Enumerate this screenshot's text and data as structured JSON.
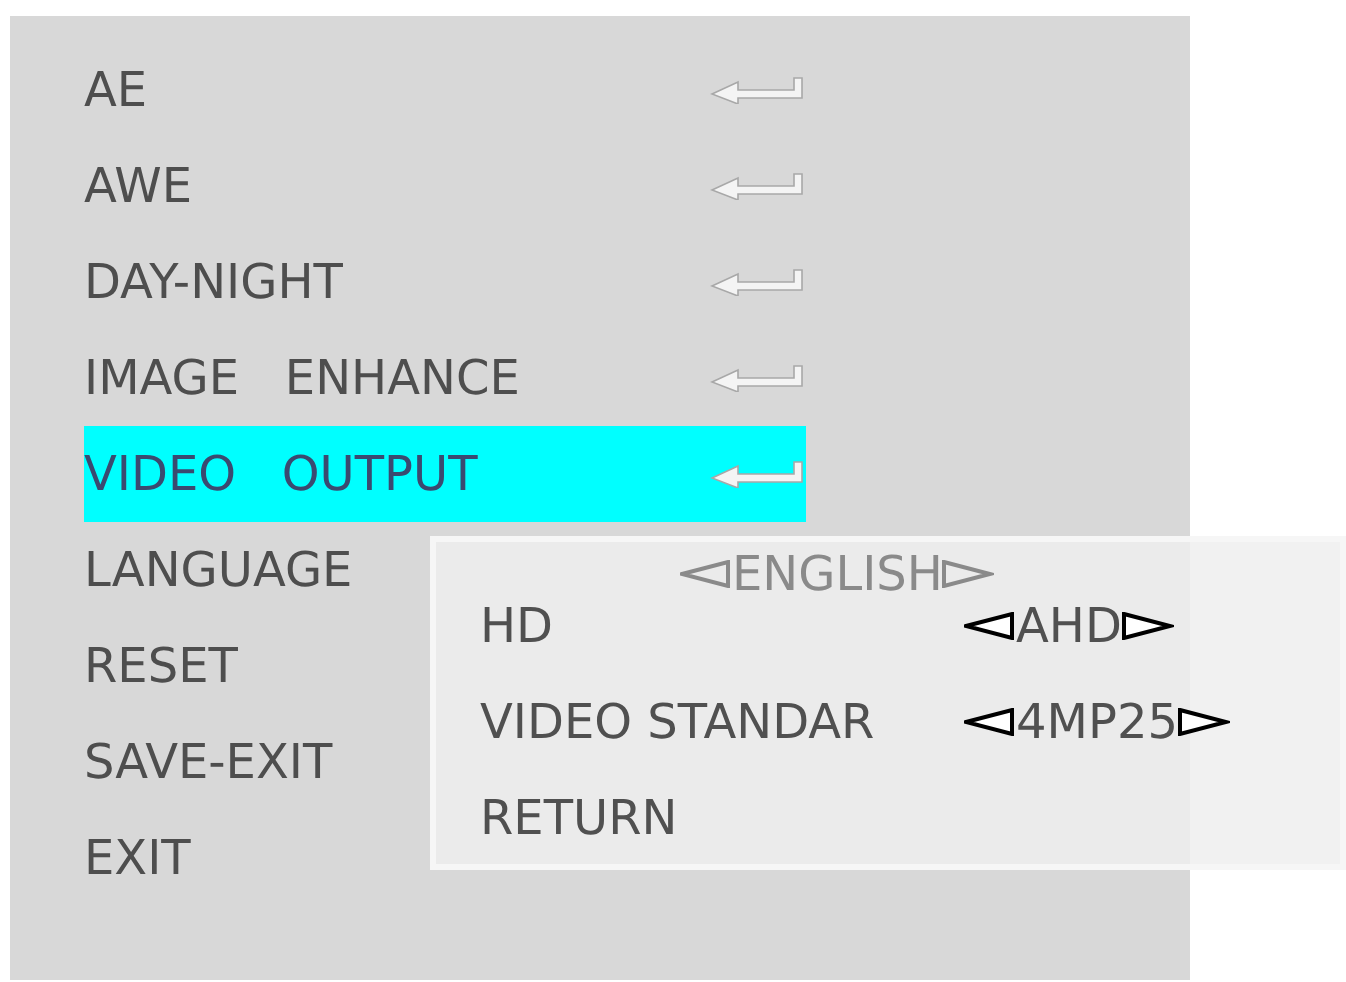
{
  "menu": {
    "items": [
      {
        "label": "AE",
        "kind": "submenu",
        "selected": false
      },
      {
        "label": "AWE",
        "kind": "submenu",
        "selected": false
      },
      {
        "label": "DAY-NIGHT",
        "kind": "submenu",
        "selected": false
      },
      {
        "label": "IMAGE   ENHANCE",
        "kind": "submenu",
        "selected": false
      },
      {
        "label": "VIDEO   OUTPUT",
        "kind": "submenu",
        "selected": true
      },
      {
        "label": "LANGUAGE",
        "kind": "option",
        "selected": false,
        "value": "ENGLISH"
      },
      {
        "label": "RESET",
        "kind": "action",
        "selected": false
      },
      {
        "label": "SAVE-EXIT",
        "kind": "action",
        "selected": false
      },
      {
        "label": "EXIT",
        "kind": "action",
        "selected": false
      }
    ]
  },
  "submenu": {
    "items": [
      {
        "label": "HD",
        "kind": "option",
        "value": "AHD"
      },
      {
        "label": "VIDEO STANDAR",
        "kind": "option",
        "value": "4MP25"
      },
      {
        "label": "RETURN",
        "kind": "action"
      }
    ]
  }
}
